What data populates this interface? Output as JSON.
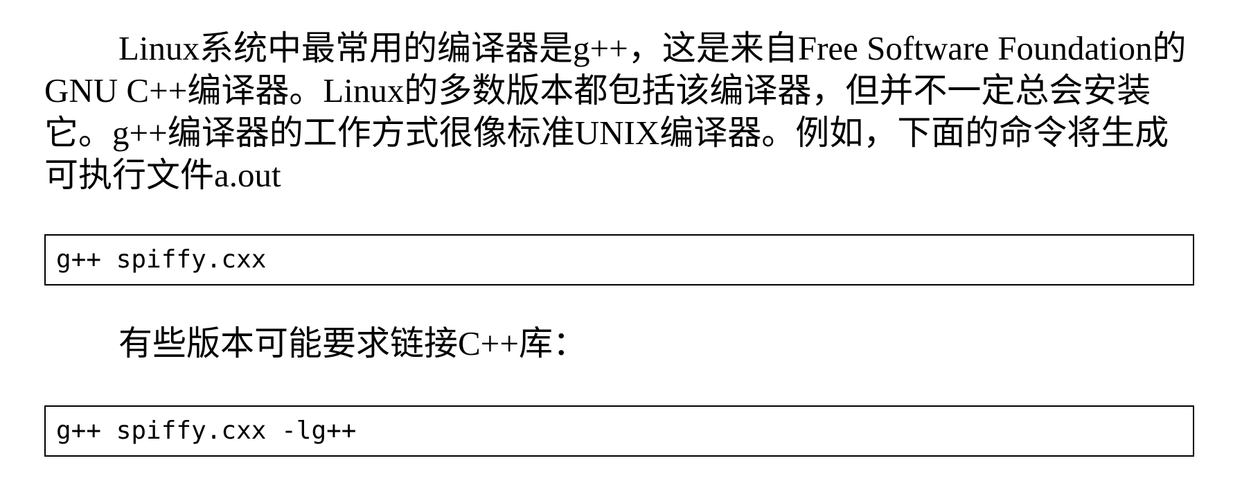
{
  "document": {
    "paragraph_1": "Linux系统中最常用的编译器是g++，这是来自Free Software Foundation的GNU C++编译器。Linux的多数版本都包括该编译器，但并不一定总会安装它。g++编译器的工作方式很像标准UNIX编译器。例如，下面的命令将生成可执行文件a.out",
    "code_1": "g++ spiffy.cxx",
    "paragraph_2": "有些版本可能要求链接C++库：",
    "code_2": "g++ spiffy.cxx -lg++"
  }
}
